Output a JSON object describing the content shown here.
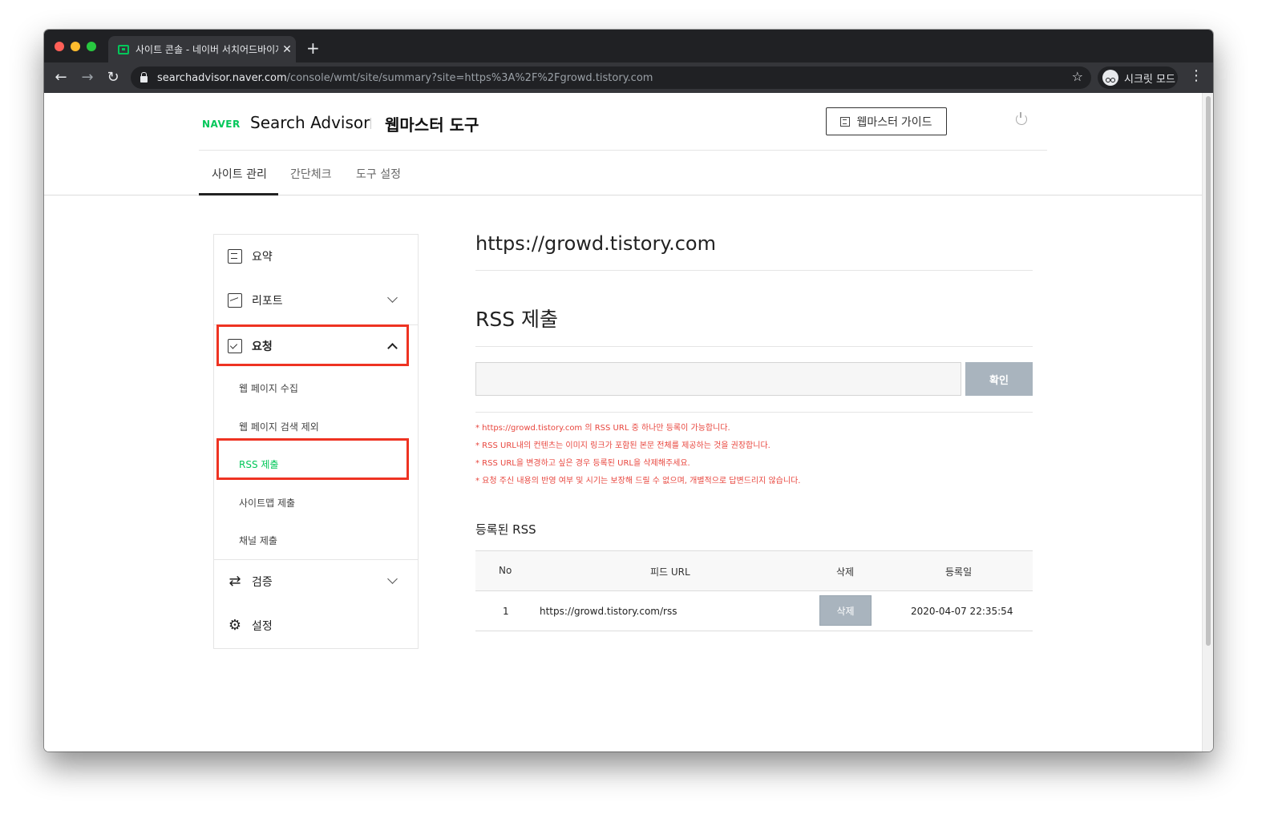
{
  "browser": {
    "tab_title": "사이트 콘솔 - 네이버 서치어드바이저",
    "tab_close": "✕",
    "new_tab": "+",
    "url_host": "searchadvisor.naver.com",
    "url_path": "/console/wmt/site/summary?site=https%3A%2F%2Fgrowd.tistory.com",
    "incognito_label": "시크릿 모드",
    "icons": [
      "back-icon",
      "forward-icon",
      "reload-icon",
      "lock-icon",
      "star-icon",
      "incognito-icon",
      "menu-icon"
    ]
  },
  "header": {
    "logo": "NAVER",
    "brand": "Search Advisor",
    "tool_name": "웹마스터 도구",
    "guide_button": "웹마스터 가이드"
  },
  "gnb": {
    "items": [
      {
        "label": "사이트 관리",
        "active": true
      },
      {
        "label": "간단체크",
        "active": false
      },
      {
        "label": "도구 설정",
        "active": false
      }
    ]
  },
  "sidebar": {
    "summary": "요약",
    "report": "리포트",
    "request": "요청",
    "request_subitems": [
      {
        "label": "웹 페이지 수집"
      },
      {
        "label": "웹 페이지 검색 제외"
      },
      {
        "label": "RSS 제출",
        "active": true
      },
      {
        "label": "사이트맵 제출"
      },
      {
        "label": "채널 제출"
      }
    ],
    "verify": "검증",
    "settings": "설정"
  },
  "content": {
    "site_url": "https://growd.tistory.com",
    "section_title": "RSS 제출",
    "input_value": "",
    "input_placeholder": "",
    "confirm_button": "확인",
    "notices": [
      "* https://growd.tistory.com 의 RSS URL 중 하나만 등록이 가능합니다.",
      "* RSS URL내의 컨텐츠는 이미지 링크가 포함된 본문 전체를 제공하는 것을 권장합니다.",
      "* RSS URL을 변경하고 싶은 경우 등록된 URL을 삭제해주세요.",
      "* 요청 주신 내용의 반영 여부 및 시기는 보장해 드릴 수 없으며, 개별적으로 답변드리지 않습니다."
    ],
    "registered_title": "등록된 RSS",
    "table": {
      "headers": [
        "No",
        "피드 URL",
        "삭제",
        "등록일"
      ],
      "rows": [
        {
          "no": "1",
          "feed_url": "https://growd.tistory.com/rss",
          "delete_label": "삭제",
          "date": "2020-04-07 22:35:54"
        }
      ]
    }
  },
  "colors": {
    "accent": "#03c75a",
    "highlight": "#ee3322",
    "notice": "#e8463e",
    "button_disabled": "#a9b4be"
  }
}
